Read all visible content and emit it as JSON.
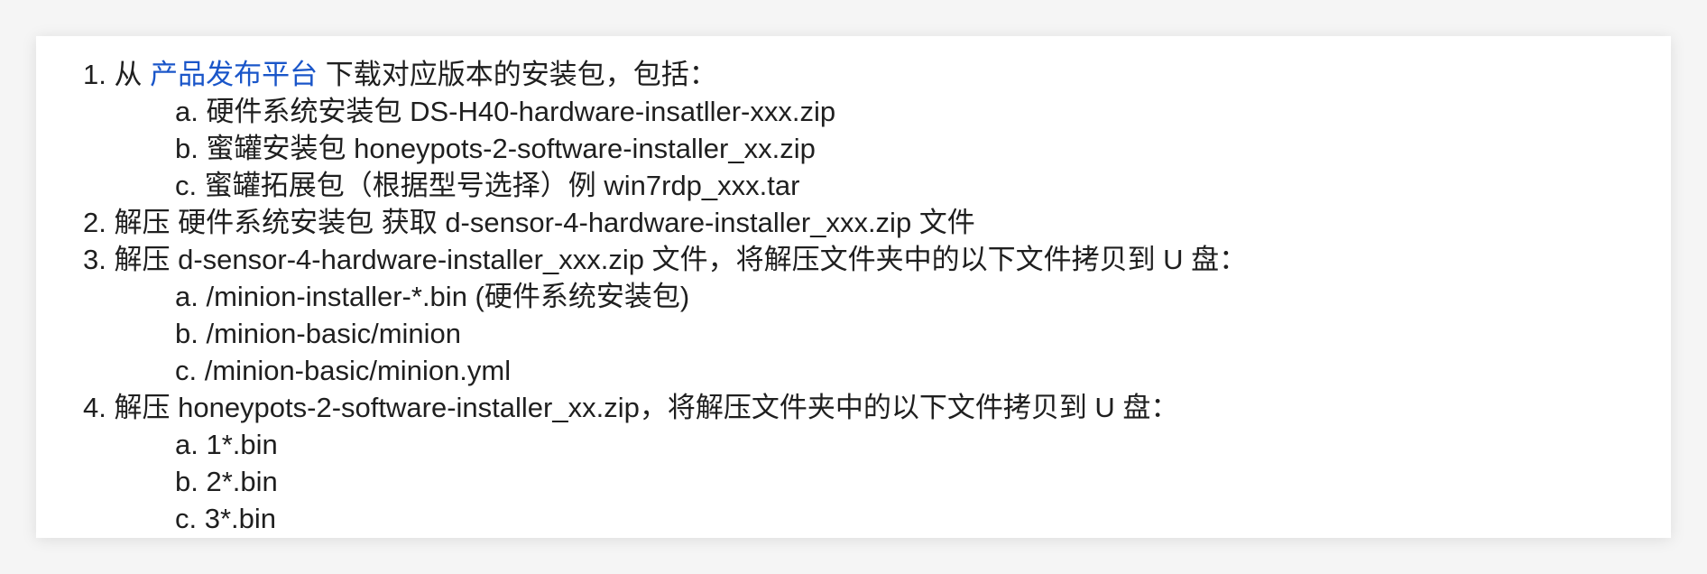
{
  "steps": [
    {
      "num": "1.",
      "pre": "从 ",
      "link": "产品发布平台",
      "post": " 下载对应版本的安装包，包括：",
      "subs": [
        {
          "num": "a.",
          "text": "硬件系统安装包 DS-H40-hardware-insatller-xxx.zip"
        },
        {
          "num": "b.",
          "text": "蜜罐安装包 honeypots-2-software-installer_xx.zip"
        },
        {
          "num": "c.",
          "text": "蜜罐拓展包（根据型号选择）例 win7rdp_xxx.tar"
        }
      ]
    },
    {
      "num": "2.",
      "text": "解压 硬件系统安装包 获取 d-sensor-4-hardware-installer_xxx.zip 文件"
    },
    {
      "num": "3.",
      "text": "解压 d-sensor-4-hardware-installer_xxx.zip 文件，将解压文件夹中的以下文件拷贝到 U 盘：",
      "subs": [
        {
          "num": "a.",
          "text": "/minion-installer-*.bin (硬件系统安装包)"
        },
        {
          "num": "b.",
          "text": "/minion-basic/minion"
        },
        {
          "num": "c.",
          "text": "/minion-basic/minion.yml"
        }
      ]
    },
    {
      "num": "4.",
      "text": "解压 honeypots-2-software-installer_xx.zip，将解压文件夹中的以下文件拷贝到 U 盘：",
      "subs": [
        {
          "num": "a.",
          "text": "1*.bin"
        },
        {
          "num": "b.",
          "text": "2*.bin"
        },
        {
          "num": "c.",
          "text": "3*.bin"
        }
      ]
    }
  ],
  "colors": {
    "text": "#1f1f1f",
    "link": "#1a56c9"
  }
}
